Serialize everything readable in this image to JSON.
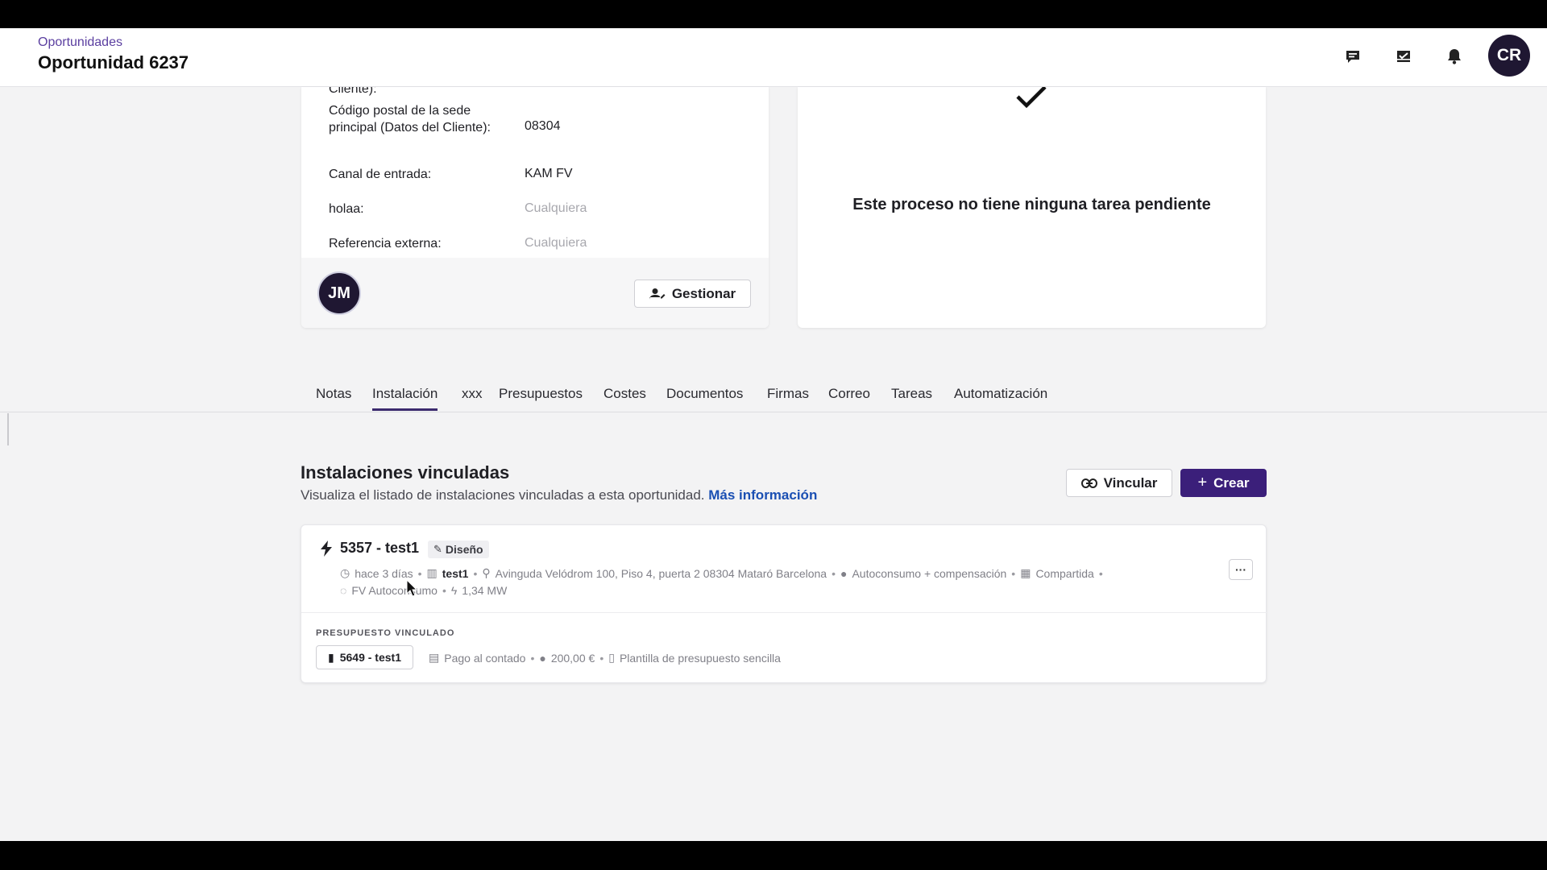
{
  "header": {
    "breadcrumb": "Oportunidades",
    "title": "Oportunidad 6237",
    "icons": [
      "chat-icon",
      "inbox-icon",
      "bell-icon"
    ],
    "user_initials": "CR"
  },
  "client_card": {
    "partial_top_label": "Cliente):",
    "fields": [
      {
        "label": "Código postal de la sede principal (Datos del Cliente):",
        "value": "08304",
        "muted": false
      },
      {
        "label": "Canal de entrada:",
        "value": "KAM FV",
        "muted": false
      },
      {
        "label": "holaa:",
        "value": "Cualquiera",
        "muted": true
      },
      {
        "label": "Referencia externa:",
        "value": "Cualquiera",
        "muted": true
      }
    ],
    "owner_initials": "JM",
    "manage_label": "Gestionar"
  },
  "tasks_card": {
    "message": "Este proceso no tiene ninguna tarea pendiente"
  },
  "tabs": [
    "Notas",
    "Instalación",
    "xxx",
    "Presupuestos",
    "Costes",
    "Documentos",
    "Firmas",
    "Correo",
    "Tareas",
    "Automatización"
  ],
  "active_tab": "Instalación",
  "section": {
    "title": "Instalaciones vinculadas",
    "subtitle": "Visualiza el listado de instalaciones vinculadas a esta oportunidad.",
    "more_info": "Más información",
    "link_label": "Vincular",
    "create_label": "Crear"
  },
  "installation": {
    "title": "5357 - test1",
    "badge": "Diseño",
    "time": "hace 3 días",
    "client": "test1",
    "address": "Avinguda Velódrom 100, Piso 4, puerta 2 08304 Mataró Barcelona",
    "mode": "Autoconsumo + compensación",
    "shared": "Compartida",
    "type": "FV Autoconsumo",
    "power": "1,34 MW",
    "more_label": "···",
    "linked_budget_label": "PRESUPUESTO VINCULADO",
    "budget_title": "5649 - test1",
    "payment": "Pago al contado",
    "amount": "200,00 €",
    "template": "Plantilla de presupuesto sencilla"
  },
  "colors": {
    "accent": "#3b1f7a",
    "link": "#1a4fb3",
    "breadcrumb": "#5b3fa0"
  }
}
